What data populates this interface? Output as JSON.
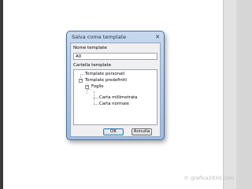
{
  "dialog": {
    "title": "Salva come template",
    "name_label": "Nome template",
    "name_value": "A0",
    "folder_label": "Cartella template",
    "tree": [
      {
        "label": "Template personali"
      },
      {
        "label": "Template predefiniti"
      },
      {
        "label": "Foglie"
      },
      {
        "label": "Carta millimetrata"
      },
      {
        "label": "Carta normale"
      }
    ],
    "ok_label": "OK",
    "cancel_label": "Annulla"
  },
  "watermark": "© grafica2d3d.com"
}
